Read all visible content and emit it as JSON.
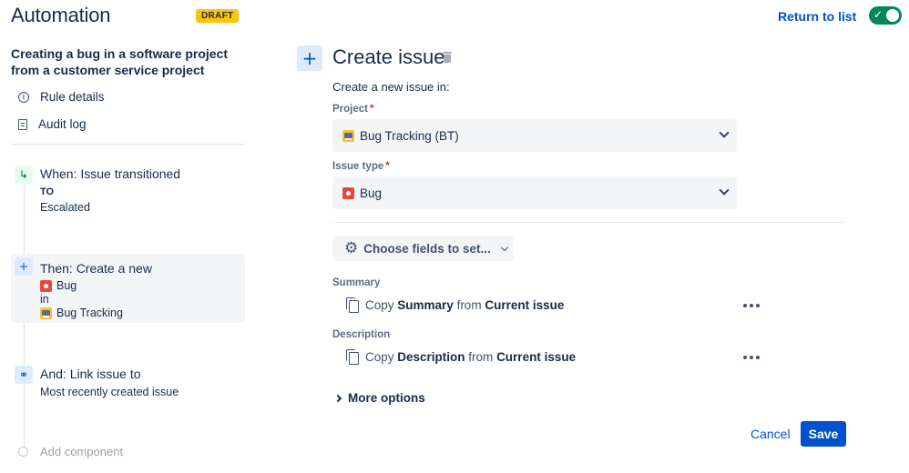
{
  "header": {
    "title": "Automation",
    "badge": "DRAFT",
    "return_link": "Return to list",
    "toggle_checkmark": "✓"
  },
  "sidebar": {
    "rule_title": "Creating a bug in a software project from a customer service project",
    "links": [
      {
        "label": "Rule details",
        "icon": "info-icon"
      },
      {
        "label": "Audit log",
        "icon": "document-icon"
      }
    ],
    "components": {
      "trigger": {
        "title": "When: Issue transitioned",
        "line1": "TO",
        "line2": "Escalated",
        "icon": "transition-icon",
        "icon_color": "#e3fcef"
      },
      "action": {
        "title": "Then: Create a new",
        "issue_type": "Bug",
        "connector": "in",
        "project": "Bug Tracking",
        "icon": "plus-icon",
        "icon_color": "#deebff"
      },
      "branch": {
        "title": "And: Link issue to",
        "line1": "Most recently created issue",
        "icon": "link-icon",
        "icon_color": "#deebff"
      }
    },
    "add_component": "Add component"
  },
  "main": {
    "title": "Create issue",
    "subtitle": "Create a new issue in:",
    "project": {
      "label": "Project",
      "required_mark": "*",
      "value": "Bug Tracking (BT)"
    },
    "issue_type": {
      "label": "Issue type",
      "required_mark": "*",
      "value": "Bug"
    },
    "choose_fields": "Choose fields to set...",
    "fields": [
      {
        "label": "Summary",
        "pre": "Copy ",
        "field": "Summary",
        "mid": " from ",
        "source": "Current issue"
      },
      {
        "label": "Description",
        "pre": "Copy ",
        "field": "Description",
        "mid": " from ",
        "source": "Current issue"
      }
    ],
    "more_options": "More options",
    "cancel": "Cancel",
    "save": "Save"
  },
  "colors": {
    "accent": "#0052cc",
    "toggle_on": "#00875a",
    "badge": "#ffc400",
    "bug": "#e5493a",
    "required": "#de350b"
  }
}
